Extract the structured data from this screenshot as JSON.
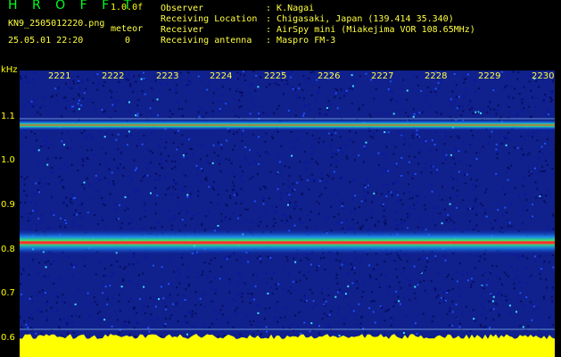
{
  "header": {
    "app_title": "H R O F F T",
    "version": "1.0.0f",
    "filename": "KN9_2505012220.png",
    "datetime": "25.05.01 22:20",
    "meteor_label": "meteor",
    "meteor_count": "0",
    "info": [
      {
        "label": "Observer",
        "value": "K.Nagai"
      },
      {
        "label": "Receiving Location",
        "value": "Chigasaki, Japan (139.414 35.340)"
      },
      {
        "label": "Receiver",
        "value": "AirSpy mini (Miakejima VOR 108.65MHz)"
      },
      {
        "label": "Receiving antenna",
        "value": "Maspro FM-3"
      }
    ]
  },
  "spectrogram": {
    "unit": "kHz",
    "y_ticks": [
      "1.1",
      "1.0",
      "0.9",
      "0.8",
      "0.7",
      "0.6"
    ],
    "x_ticks": [
      "2221",
      "2222",
      "2223",
      "2224",
      "2225",
      "2226",
      "2227",
      "2228",
      "2229",
      "2230"
    ],
    "colors": {
      "background": "#000000",
      "noise": "#10208c",
      "signal": "#ff3030",
      "level": "#ffff00"
    }
  }
}
